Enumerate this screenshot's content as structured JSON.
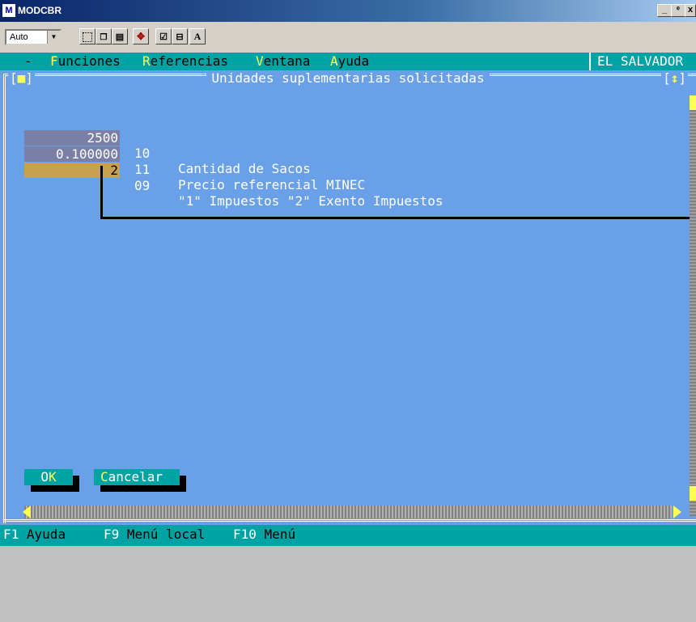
{
  "window": {
    "title": "MODCBR",
    "icon": "app-icon",
    "controls": [
      "_",
      "ᵉ",
      "x"
    ]
  },
  "toolbar": {
    "font_select": "Auto",
    "buttons": [
      "select-icon",
      "copy-icon",
      "paste-icon",
      "fullscreen-icon",
      "properties-icon",
      "background-icon",
      "font-icon"
    ],
    "font_button_label": "A"
  },
  "menubar": {
    "system": "-",
    "items": [
      {
        "hotkey": "F",
        "rest": "unciones"
      },
      {
        "hotkey": "R",
        "rest": "eferencias"
      },
      {
        "hotkey": "V",
        "rest": "entana"
      },
      {
        "hotkey": "A",
        "rest": "yuda"
      }
    ],
    "region": "EL SALVADOR"
  },
  "dialog": {
    "title": "Unidades suplementarias solicitadas",
    "close_box": "■",
    "zoom_box": "↕",
    "rows": [
      {
        "value": "2500",
        "code": "10",
        "label": "Cantidad de Sacos",
        "bg": "#7b7fa6"
      },
      {
        "value": "0.100000",
        "code": "11",
        "label": "Precio referencial MINEC",
        "bg": "#7b7fa6"
      },
      {
        "value": "2",
        "code": "09",
        "label": "\"1\" Impuestos \"2\" Exento Impuestos",
        "bg": "#c8a050"
      }
    ],
    "ok_button": {
      "hotkey": "K",
      "prefix": "O"
    },
    "cancel_button": {
      "hotkey": "C",
      "rest": "ancelar"
    }
  },
  "statusbar": [
    {
      "key": "F1",
      "label": "Ayuda"
    },
    {
      "key": "F9",
      "label": "Menú local"
    },
    {
      "key": "F10",
      "label": "Menú"
    }
  ],
  "colors": {
    "screen_bg": "#6aa0e8",
    "bar_bg": "#00a3a3",
    "hotkey": "#ffff55"
  }
}
